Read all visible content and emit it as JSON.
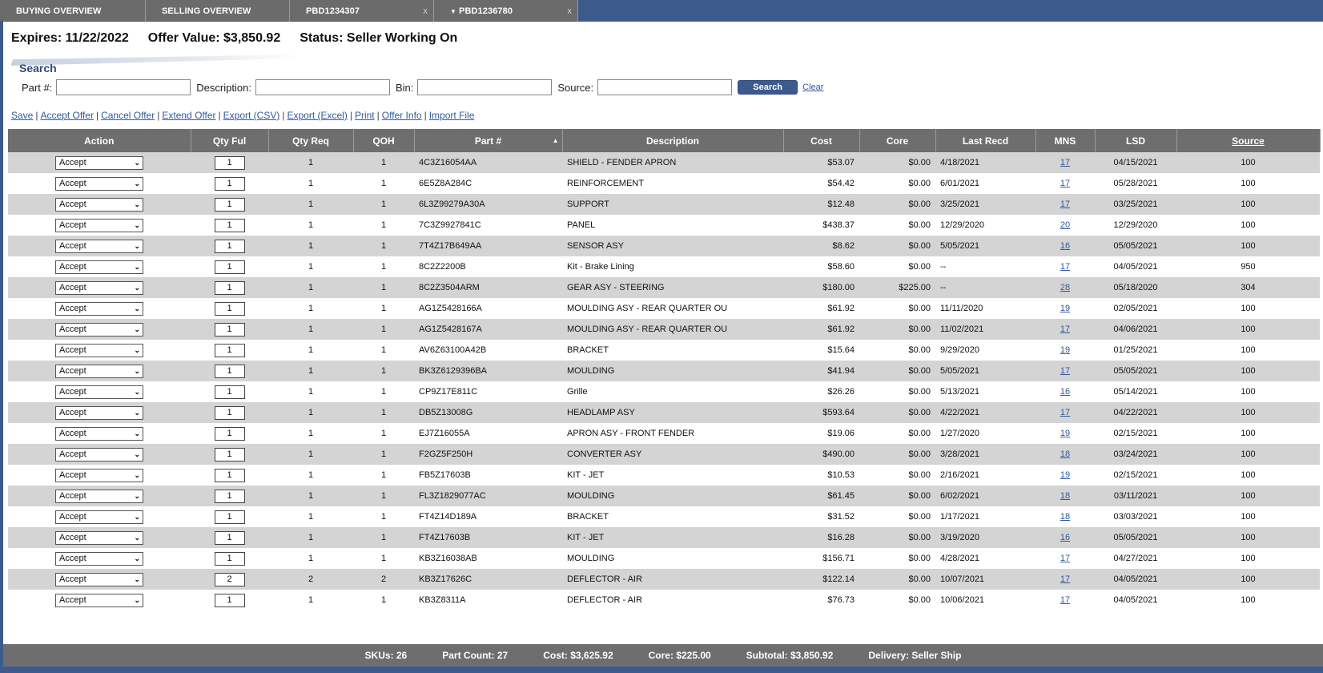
{
  "tabs": [
    {
      "label": "BUYING OVERVIEW",
      "width": 182,
      "closable": false,
      "active": false
    },
    {
      "label": "SELLING OVERVIEW",
      "width": 180,
      "closable": false,
      "active": false
    },
    {
      "label": "PBD1234307",
      "width": 180,
      "closable": true,
      "active": false
    },
    {
      "label": "PBD1236780",
      "width": 180,
      "closable": true,
      "active": true
    }
  ],
  "tab_close_glyph": "x",
  "header": {
    "expires": "Expires: 11/22/2022",
    "offer_value": "Offer Value: $3,850.92",
    "status": "Status: Seller Working On"
  },
  "search": {
    "title": "Search",
    "part_label": "Part #:",
    "desc_label": "Description:",
    "bin_label": "Bin:",
    "source_label": "Source:",
    "button": "Search",
    "clear": "Clear"
  },
  "actions": [
    "Save",
    "Accept Offer",
    "Cancel Offer",
    "Extend Offer",
    "Export (CSV)",
    "Export (Excel)",
    "Print",
    "Offer Info",
    "Import File"
  ],
  "table": {
    "headers": {
      "action": "Action",
      "qty_ful": "Qty Ful",
      "qty_req": "Qty Req",
      "qoh": "QOH",
      "part": "Part #",
      "desc": "Description",
      "cost": "Cost",
      "core": "Core",
      "last_recd": "Last Recd",
      "mns": "MNS",
      "lsd": "LSD",
      "source": "Source"
    },
    "sort_column": "part",
    "rows": [
      {
        "action": "Accept",
        "qty_ful": "1",
        "qty_req": "1",
        "qoh": "1",
        "part": "4C3Z16054AA",
        "desc": "SHIELD - FENDER APRON",
        "cost": "$53.07",
        "core": "$0.00",
        "last_recd": "4/18/2021",
        "mns": "17",
        "lsd": "04/15/2021",
        "source": "100"
      },
      {
        "action": "Accept",
        "qty_ful": "1",
        "qty_req": "1",
        "qoh": "1",
        "part": "6E5Z8A284C",
        "desc": "REINFORCEMENT",
        "cost": "$54.42",
        "core": "$0.00",
        "last_recd": "6/01/2021",
        "mns": "17",
        "lsd": "05/28/2021",
        "source": "100"
      },
      {
        "action": "Accept",
        "qty_ful": "1",
        "qty_req": "1",
        "qoh": "1",
        "part": "6L3Z99279A30A",
        "desc": "SUPPORT",
        "cost": "$12.48",
        "core": "$0.00",
        "last_recd": "3/25/2021",
        "mns": "17",
        "lsd": "03/25/2021",
        "source": "100"
      },
      {
        "action": "Accept",
        "qty_ful": "1",
        "qty_req": "1",
        "qoh": "1",
        "part": "7C3Z9927841C",
        "desc": "PANEL",
        "cost": "$438.37",
        "core": "$0.00",
        "last_recd": "12/29/2020",
        "mns": "20",
        "lsd": "12/29/2020",
        "source": "100"
      },
      {
        "action": "Accept",
        "qty_ful": "1",
        "qty_req": "1",
        "qoh": "1",
        "part": "7T4Z17B649AA",
        "desc": "SENSOR ASY",
        "cost": "$8.62",
        "core": "$0.00",
        "last_recd": "5/05/2021",
        "mns": "16",
        "lsd": "05/05/2021",
        "source": "100"
      },
      {
        "action": "Accept",
        "qty_ful": "1",
        "qty_req": "1",
        "qoh": "1",
        "part": "8C2Z2200B",
        "desc": "Kit - Brake Lining",
        "cost": "$58.60",
        "core": "$0.00",
        "last_recd": "--",
        "mns": "17",
        "lsd": "04/05/2021",
        "source": "950"
      },
      {
        "action": "Accept",
        "qty_ful": "1",
        "qty_req": "1",
        "qoh": "1",
        "part": "8C2Z3504ARM",
        "desc": "GEAR ASY - STEERING",
        "cost": "$180.00",
        "core": "$225.00",
        "last_recd": "--",
        "mns": "28",
        "lsd": "05/18/2020",
        "source": "304"
      },
      {
        "action": "Accept",
        "qty_ful": "1",
        "qty_req": "1",
        "qoh": "1",
        "part": "AG1Z5428166A",
        "desc": "MOULDING ASY - REAR QUARTER OU",
        "cost": "$61.92",
        "core": "$0.00",
        "last_recd": "11/11/2020",
        "mns": "19",
        "lsd": "02/05/2021",
        "source": "100"
      },
      {
        "action": "Accept",
        "qty_ful": "1",
        "qty_req": "1",
        "qoh": "1",
        "part": "AG1Z5428167A",
        "desc": "MOULDING ASY - REAR QUARTER OU",
        "cost": "$61.92",
        "core": "$0.00",
        "last_recd": "11/02/2021",
        "mns": "17",
        "lsd": "04/06/2021",
        "source": "100"
      },
      {
        "action": "Accept",
        "qty_ful": "1",
        "qty_req": "1",
        "qoh": "1",
        "part": "AV6Z63100A42B",
        "desc": "BRACKET",
        "cost": "$15.64",
        "core": "$0.00",
        "last_recd": "9/29/2020",
        "mns": "19",
        "lsd": "01/25/2021",
        "source": "100"
      },
      {
        "action": "Accept",
        "qty_ful": "1",
        "qty_req": "1",
        "qoh": "1",
        "part": "BK3Z6129396BA",
        "desc": "MOULDING",
        "cost": "$41.94",
        "core": "$0.00",
        "last_recd": "5/05/2021",
        "mns": "17",
        "lsd": "05/05/2021",
        "source": "100"
      },
      {
        "action": "Accept",
        "qty_ful": "1",
        "qty_req": "1",
        "qoh": "1",
        "part": "CP9Z17E811C",
        "desc": "Grille",
        "cost": "$26.26",
        "core": "$0.00",
        "last_recd": "5/13/2021",
        "mns": "16",
        "lsd": "05/14/2021",
        "source": "100"
      },
      {
        "action": "Accept",
        "qty_ful": "1",
        "qty_req": "1",
        "qoh": "1",
        "part": "DB5Z13008G",
        "desc": "HEADLAMP ASY",
        "cost": "$593.64",
        "core": "$0.00",
        "last_recd": "4/22/2021",
        "mns": "17",
        "lsd": "04/22/2021",
        "source": "100"
      },
      {
        "action": "Accept",
        "qty_ful": "1",
        "qty_req": "1",
        "qoh": "1",
        "part": "EJ7Z16055A",
        "desc": "APRON ASY - FRONT FENDER",
        "cost": "$19.06",
        "core": "$0.00",
        "last_recd": "1/27/2020",
        "mns": "19",
        "lsd": "02/15/2021",
        "source": "100"
      },
      {
        "action": "Accept",
        "qty_ful": "1",
        "qty_req": "1",
        "qoh": "1",
        "part": "F2GZ5F250H",
        "desc": "CONVERTER ASY",
        "cost": "$490.00",
        "core": "$0.00",
        "last_recd": "3/28/2021",
        "mns": "18",
        "lsd": "03/24/2021",
        "source": "100"
      },
      {
        "action": "Accept",
        "qty_ful": "1",
        "qty_req": "1",
        "qoh": "1",
        "part": "FB5Z17603B",
        "desc": "KIT - JET",
        "cost": "$10.53",
        "core": "$0.00",
        "last_recd": "2/16/2021",
        "mns": "19",
        "lsd": "02/15/2021",
        "source": "100"
      },
      {
        "action": "Accept",
        "qty_ful": "1",
        "qty_req": "1",
        "qoh": "1",
        "part": "FL3Z1829077AC",
        "desc": "MOULDING",
        "cost": "$61.45",
        "core": "$0.00",
        "last_recd": "6/02/2021",
        "mns": "18",
        "lsd": "03/11/2021",
        "source": "100"
      },
      {
        "action": "Accept",
        "qty_ful": "1",
        "qty_req": "1",
        "qoh": "1",
        "part": "FT4Z14D189A",
        "desc": "BRACKET",
        "cost": "$31.52",
        "core": "$0.00",
        "last_recd": "1/17/2021",
        "mns": "18",
        "lsd": "03/03/2021",
        "source": "100"
      },
      {
        "action": "Accept",
        "qty_ful": "1",
        "qty_req": "1",
        "qoh": "1",
        "part": "FT4Z17603B",
        "desc": "KIT - JET",
        "cost": "$16.28",
        "core": "$0.00",
        "last_recd": "3/19/2020",
        "mns": "16",
        "lsd": "05/05/2021",
        "source": "100"
      },
      {
        "action": "Accept",
        "qty_ful": "1",
        "qty_req": "1",
        "qoh": "1",
        "part": "KB3Z16038AB",
        "desc": "MOULDING",
        "cost": "$156.71",
        "core": "$0.00",
        "last_recd": "4/28/2021",
        "mns": "17",
        "lsd": "04/27/2021",
        "source": "100"
      },
      {
        "action": "Accept",
        "qty_ful": "2",
        "qty_req": "2",
        "qoh": "2",
        "part": "KB3Z17626C",
        "desc": "DEFLECTOR - AIR",
        "cost": "$122.14",
        "core": "$0.00",
        "last_recd": "10/07/2021",
        "mns": "17",
        "lsd": "04/05/2021",
        "source": "100"
      },
      {
        "action": "Accept",
        "qty_ful": "1",
        "qty_req": "1",
        "qoh": "1",
        "part": "KB3Z8311A",
        "desc": "DEFLECTOR - AIR",
        "cost": "$76.73",
        "core": "$0.00",
        "last_recd": "10/06/2021",
        "mns": "17",
        "lsd": "04/05/2021",
        "source": "100"
      }
    ]
  },
  "footer": {
    "skus": "SKUs: 26",
    "part_count": "Part Count: 27",
    "cost": "Cost: $3,625.92",
    "core": "Core: $225.00",
    "subtotal": "Subtotal: $3,850.92",
    "delivery": "Delivery: Seller Ship"
  }
}
